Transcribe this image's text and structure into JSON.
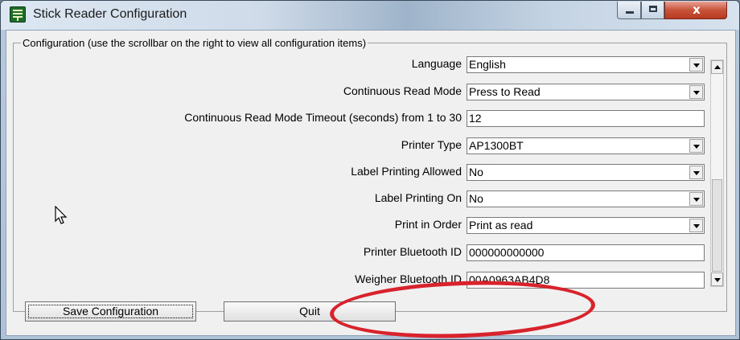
{
  "window": {
    "title": "Stick Reader Configuration",
    "app_icon": "green-reader-icon",
    "close_glyph": "x"
  },
  "group": {
    "legend": "Configuration (use the scrollbar on the right to view all configuration items)"
  },
  "config_items": [
    {
      "label": "Language",
      "value": "English",
      "type": "dropdown"
    },
    {
      "label": "Continuous Read Mode",
      "value": "Press to Read",
      "type": "dropdown"
    },
    {
      "label": "Continuous Read Mode Timeout (seconds) from 1 to 30",
      "value": "12",
      "type": "text"
    },
    {
      "label": "Printer Type",
      "value": "AP1300BT",
      "type": "dropdown"
    },
    {
      "label": "Label Printing Allowed",
      "value": "No",
      "type": "dropdown"
    },
    {
      "label": "Label Printing On",
      "value": "No",
      "type": "dropdown"
    },
    {
      "label": "Print in Order",
      "value": "Print as read",
      "type": "dropdown"
    },
    {
      "label": "Printer Bluetooth ID",
      "value": "000000000000",
      "type": "text"
    },
    {
      "label": "Weigher Bluetooth ID",
      "value": "00A0963AB4D8",
      "type": "text"
    }
  ],
  "buttons": {
    "save": "Save Configuration",
    "quit": "Quit"
  },
  "annotation": {
    "color": "#d9232c"
  }
}
